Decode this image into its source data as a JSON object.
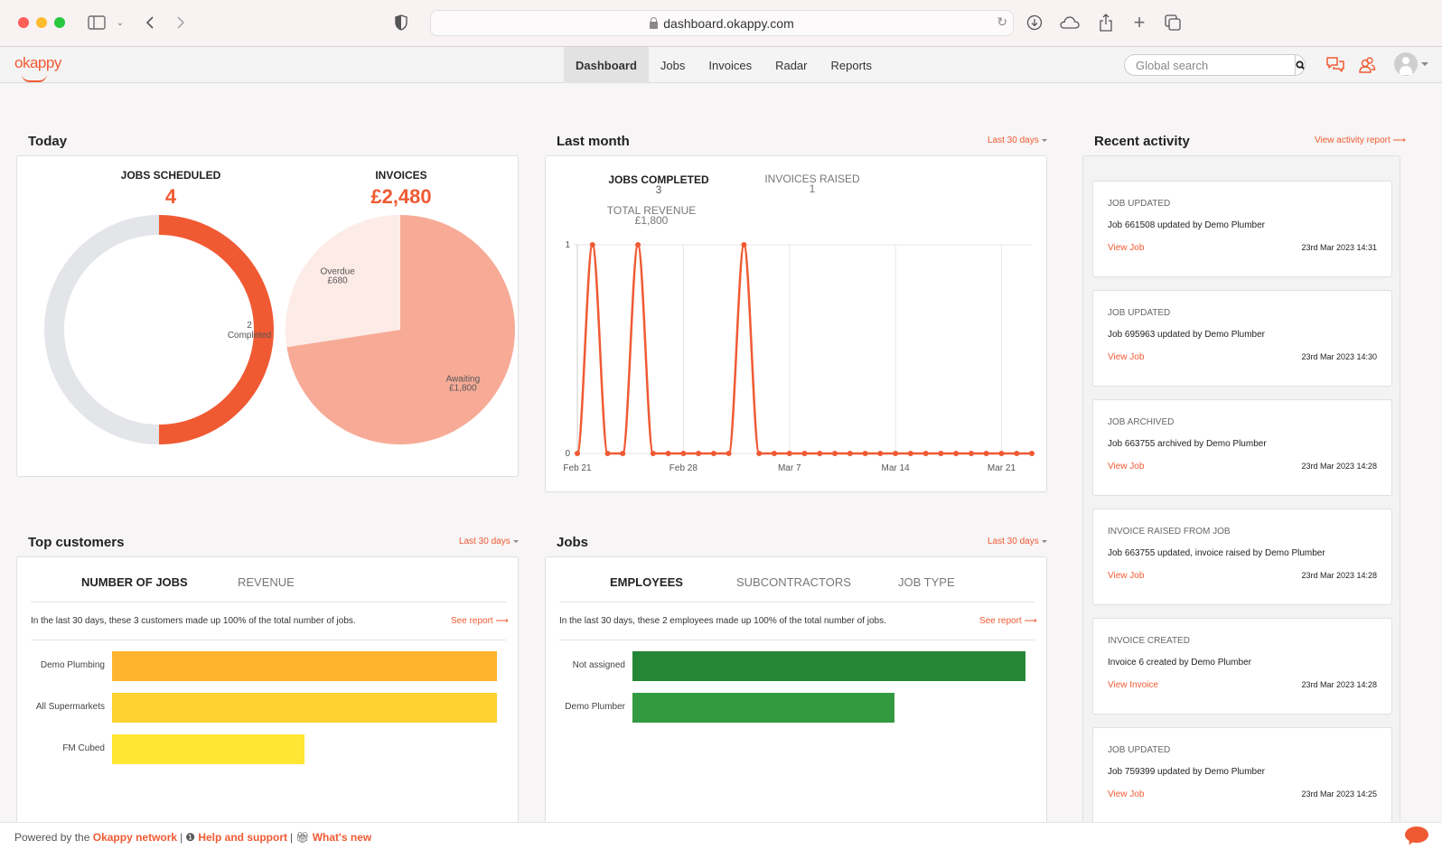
{
  "browser": {
    "url": "dashboard.okappy.com"
  },
  "app": {
    "logo": "okappy",
    "nav": [
      {
        "label": "Dashboard",
        "active": true
      },
      {
        "label": "Jobs",
        "active": false
      },
      {
        "label": "Invoices",
        "active": false
      },
      {
        "label": "Radar",
        "active": false
      },
      {
        "label": "Reports",
        "active": false
      }
    ],
    "search_placeholder": "Global search",
    "icons": [
      "messages-icon",
      "contacts-icon",
      "user-avatar-icon"
    ]
  },
  "today": {
    "title": "Today",
    "jobs_scheduled_label": "JOBS SCHEDULED",
    "jobs_scheduled_value": "4",
    "invoices_label": "INVOICES",
    "invoices_value": "£2,480"
  },
  "last_month": {
    "title": "Last month",
    "range_label": "Last 30 days",
    "jobs_completed_label": "JOBS COMPLETED",
    "jobs_completed_value": "3",
    "invoices_raised_label": "INVOICES RAISED",
    "invoices_raised_value": "1",
    "total_revenue_label": "TOTAL REVENUE",
    "total_revenue_value": "£1,800"
  },
  "top_customers": {
    "title": "Top customers",
    "range_label": "Last 30 days",
    "tabs": [
      "NUMBER OF JOBS",
      "REVENUE"
    ],
    "summary": "In the last 30 days, these 3 customers made up 100% of the total number of jobs.",
    "see_report": "See report"
  },
  "jobs": {
    "title": "Jobs",
    "range_label": "Last 30 days",
    "tabs": [
      "EMPLOYEES",
      "SUBCONTRACTORS",
      "JOB TYPE"
    ],
    "summary": "In the last 30 days, these 2 employees made up 100% of the total number of jobs.",
    "see_report": "See report"
  },
  "recent_activity": {
    "title": "Recent activity",
    "view_report": "View activity report",
    "items": [
      {
        "type": "JOB UPDATED",
        "desc": "Job 661508 updated by Demo Plumber",
        "link": "View Job",
        "time": "23rd Mar 2023 14:31"
      },
      {
        "type": "JOB UPDATED",
        "desc": "Job 695963 updated by Demo Plumber",
        "link": "View Job",
        "time": "23rd Mar 2023 14:30"
      },
      {
        "type": "JOB ARCHIVED",
        "desc": "Job 663755 archived by Demo Plumber",
        "link": "View Job",
        "time": "23rd Mar 2023 14:28"
      },
      {
        "type": "INVOICE RAISED FROM JOB",
        "desc": "Job 663755 updated, invoice raised by Demo Plumber",
        "link": "View Job",
        "time": "23rd Mar 2023 14:28"
      },
      {
        "type": "INVOICE CREATED",
        "desc": "Invoice 6 created by Demo Plumber",
        "link": "View Invoice",
        "time": "23rd Mar 2023 14:28"
      },
      {
        "type": "JOB UPDATED",
        "desc": "Job 759399 updated by Demo Plumber",
        "link": "View Job",
        "time": "23rd Mar 2023 14:25"
      }
    ]
  },
  "footer": {
    "powered_by": "Powered by the",
    "network_link": "Okappy network",
    "help_link": "Help and support",
    "whats_new_link": "What's new"
  },
  "colors": {
    "accent": "#f05a33",
    "donut_rest": "#e4e5e9",
    "pie_awaiting": "#f7ab97",
    "pie_overdue": "#fcebe7",
    "customer_bars": [
      "#feb42e",
      "#fed230",
      "#ffe733"
    ],
    "employee_bars": [
      "#258636",
      "#339a41"
    ]
  },
  "chart_data": [
    {
      "type": "pie",
      "title": "JOBS SCHEDULED",
      "variant": "donut",
      "slices": [
        {
          "label": "Completed",
          "value": 2,
          "show_label": true
        },
        {
          "label": "Remaining",
          "value": 2,
          "show_label": false
        }
      ]
    },
    {
      "type": "pie",
      "title": "INVOICES",
      "slices": [
        {
          "label": "Awaiting",
          "value": 1800,
          "display": "£1,800"
        },
        {
          "label": "Overdue",
          "value": 680,
          "display": "£680"
        }
      ]
    },
    {
      "type": "line",
      "title": "Jobs completed",
      "x": [
        "Feb 21",
        "Feb 22",
        "Feb 23",
        "Feb 24",
        "Feb 25",
        "Feb 26",
        "Feb 27",
        "Feb 28",
        "Mar 1",
        "Mar 2",
        "Mar 3",
        "Mar 4",
        "Mar 5",
        "Mar 6",
        "Mar 7",
        "Mar 8",
        "Mar 9",
        "Mar 10",
        "Mar 11",
        "Mar 12",
        "Mar 13",
        "Mar 14",
        "Mar 15",
        "Mar 16",
        "Mar 17",
        "Mar 18",
        "Mar 19",
        "Mar 20",
        "Mar 21",
        "Mar 22",
        "Mar 23"
      ],
      "values": [
        0,
        1,
        0,
        0,
        1,
        0,
        0,
        0,
        0,
        0,
        0,
        1,
        0,
        0,
        0,
        0,
        0,
        0,
        0,
        0,
        0,
        0,
        0,
        0,
        0,
        0,
        0,
        0,
        0,
        0,
        0
      ],
      "x_ticks": [
        "Feb 21",
        "Feb 28",
        "Mar 7",
        "Mar 14",
        "Mar 21"
      ],
      "y_ticks": [
        0,
        1
      ],
      "ylim": [
        0,
        1
      ],
      "grid": true
    },
    {
      "type": "bar",
      "orientation": "horizontal",
      "title": "Top customers - Number of jobs",
      "categories": [
        "Demo Plumbing",
        "All Supermarkets",
        "FM Cubed"
      ],
      "values": [
        2,
        2,
        1
      ]
    },
    {
      "type": "bar",
      "orientation": "horizontal",
      "title": "Jobs - Employees",
      "categories": [
        "Not assigned",
        "Demo Plumber"
      ],
      "values": [
        3,
        2
      ]
    }
  ]
}
